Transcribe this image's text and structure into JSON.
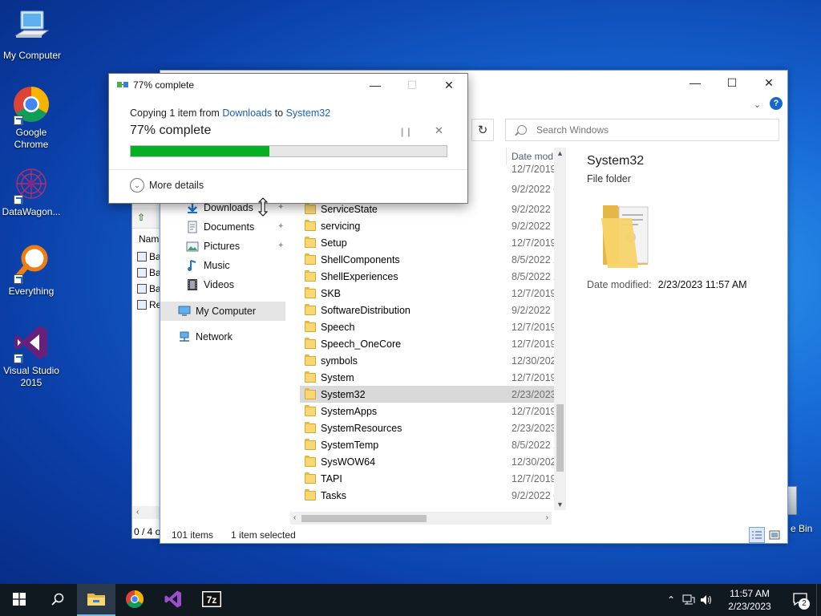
{
  "desktop": {
    "icons": [
      {
        "label": "My Computer"
      },
      {
        "label": "Google Chrome"
      },
      {
        "label": "DataWagon..."
      },
      {
        "label": "Everything"
      },
      {
        "label": "Visual Studio 2015"
      }
    ],
    "recycle_bin_label": "e Bin"
  },
  "back_window": {
    "header": "Nam",
    "rows": [
      "Ba",
      "Ba",
      "Ba",
      "Re"
    ],
    "status": "0 / 4 o"
  },
  "explorer": {
    "search_placeholder": "Search Windows",
    "column_date": "Date mod",
    "nav": [
      {
        "label": "Downloads",
        "icon": "download-icon",
        "pinned": true
      },
      {
        "label": "Documents",
        "icon": "document-icon",
        "pinned": true
      },
      {
        "label": "Pictures",
        "icon": "pictures-icon",
        "pinned": true
      },
      {
        "label": "Music",
        "icon": "music-icon",
        "pinned": false
      },
      {
        "label": "Videos",
        "icon": "video-icon",
        "pinned": false
      },
      {
        "label": "My Computer",
        "icon": "computer-icon",
        "pinned": false,
        "selected": true
      },
      {
        "label": "Network",
        "icon": "network-icon",
        "pinned": false
      }
    ],
    "partial_dates": [
      "12/7/2019",
      "9/2/2022 6"
    ],
    "files": [
      {
        "name": "ServiceState",
        "date": "9/2/2022 1"
      },
      {
        "name": "servicing",
        "date": "9/2/2022 1"
      },
      {
        "name": "Setup",
        "date": "12/7/2019"
      },
      {
        "name": "ShellComponents",
        "date": "8/5/2022 2"
      },
      {
        "name": "ShellExperiences",
        "date": "8/5/2022 2"
      },
      {
        "name": "SKB",
        "date": "12/7/2019"
      },
      {
        "name": "SoftwareDistribution",
        "date": "9/2/2022 1"
      },
      {
        "name": "Speech",
        "date": "12/7/2019"
      },
      {
        "name": "Speech_OneCore",
        "date": "12/7/2019"
      },
      {
        "name": "symbols",
        "date": "12/30/202"
      },
      {
        "name": "System",
        "date": "12/7/2019"
      },
      {
        "name": "System32",
        "date": "2/23/2023",
        "selected": true
      },
      {
        "name": "SystemApps",
        "date": "12/7/2019"
      },
      {
        "name": "SystemResources",
        "date": "2/23/2023"
      },
      {
        "name": "SystemTemp",
        "date": "8/5/2022 2"
      },
      {
        "name": "SysWOW64",
        "date": "12/30/202"
      },
      {
        "name": "TAPI",
        "date": "12/7/2019"
      },
      {
        "name": "Tasks",
        "date": "9/2/2022 6"
      }
    ],
    "details": {
      "title": "System32",
      "type": "File folder",
      "modified_label": "Date modified:",
      "modified_value": "2/23/2023 11:57 AM"
    },
    "status": {
      "items": "101 items",
      "selected": "1 item selected"
    }
  },
  "copy_dialog": {
    "title": "77% complete",
    "line_prefix": "Copying 1 item from",
    "source": "Downloads",
    "line_mid": "to",
    "destination": "System32",
    "progress_text": "77% complete",
    "progress": 0.44,
    "more_details": "More details"
  },
  "taskbar": {
    "time": "11:57 AM",
    "date": "2/23/2023",
    "notification_count": "2"
  },
  "colors": {
    "progress_fill": "#06b025",
    "link": "#1a5fb4",
    "accent": "#1468c8"
  }
}
